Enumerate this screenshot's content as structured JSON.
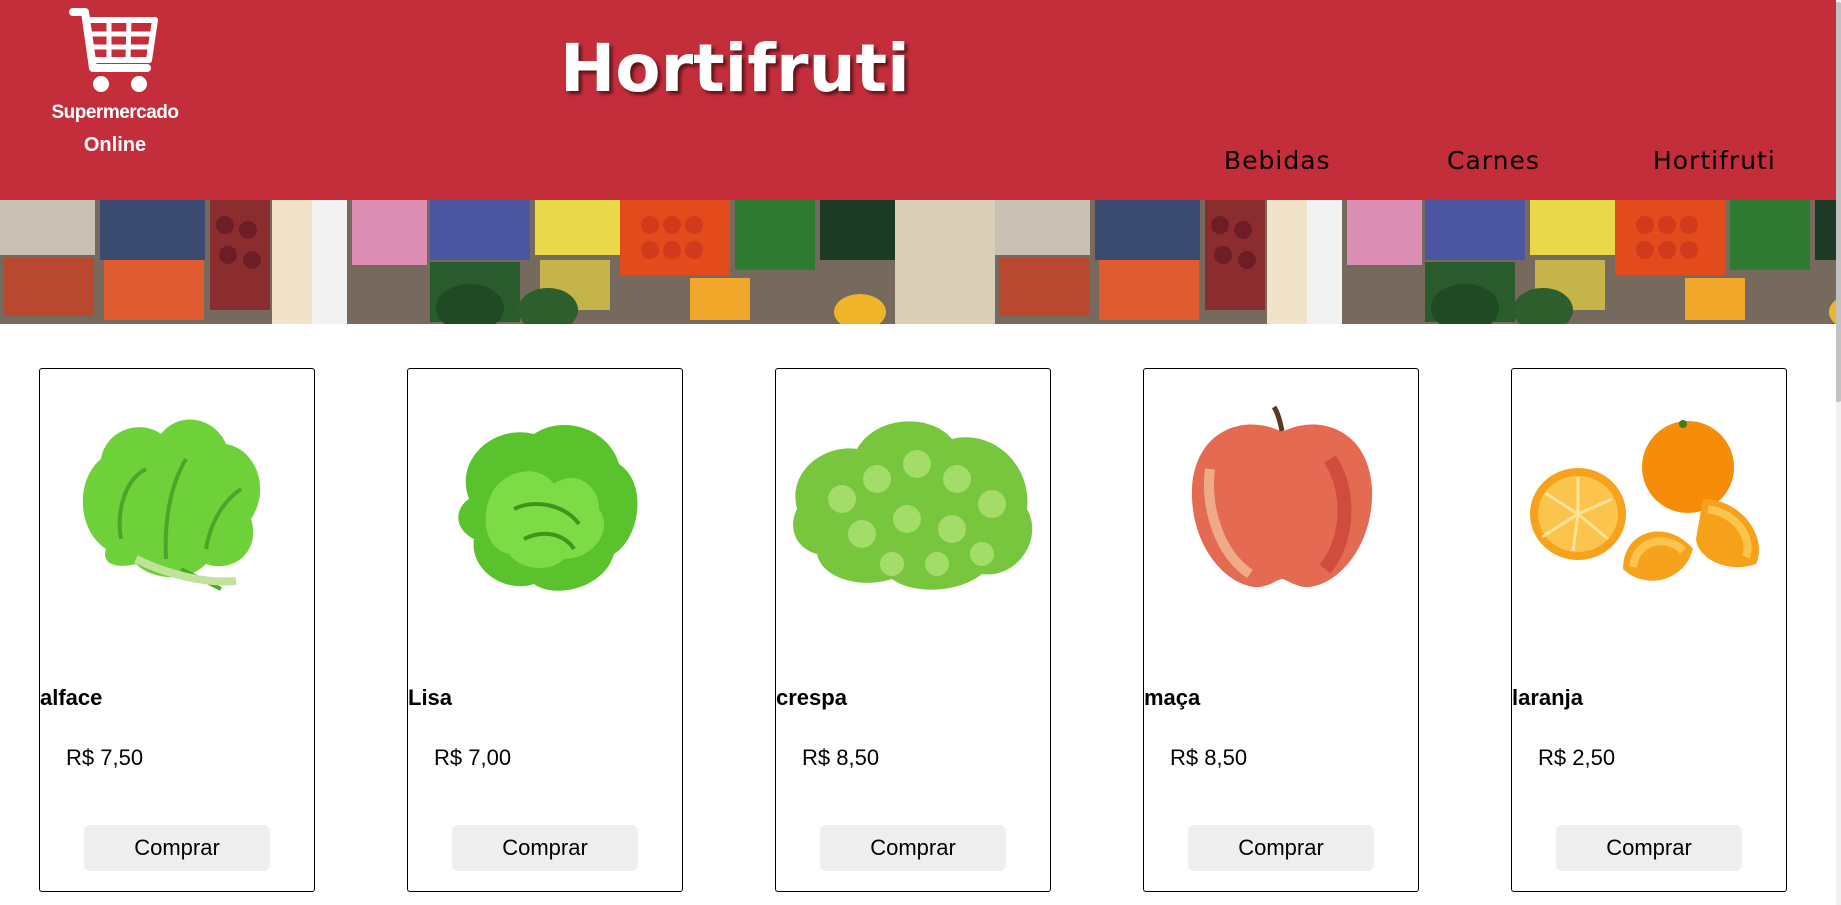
{
  "header": {
    "logo_name": "Supermercado",
    "logo_sub": "Online",
    "page_title": "Hortifruti",
    "nav": [
      "Bebidas",
      "Carnes",
      "Hortifruti"
    ],
    "background_color": "#c42d3a"
  },
  "products": [
    {
      "name": "alface",
      "price": "R$ 7,50",
      "button": "Comprar",
      "image": "lettuce-image"
    },
    {
      "name": "Lisa",
      "price": "R$ 7,00",
      "button": "Comprar",
      "image": "butter-lettuce-image"
    },
    {
      "name": "crespa",
      "price": "R$ 8,50",
      "button": "Comprar",
      "image": "curly-lettuce-image"
    },
    {
      "name": "maça",
      "price": "R$ 8,50",
      "button": "Comprar",
      "image": "apple-image"
    },
    {
      "name": "laranja",
      "price": "R$ 2,50",
      "button": "Comprar",
      "image": "orange-image"
    }
  ]
}
